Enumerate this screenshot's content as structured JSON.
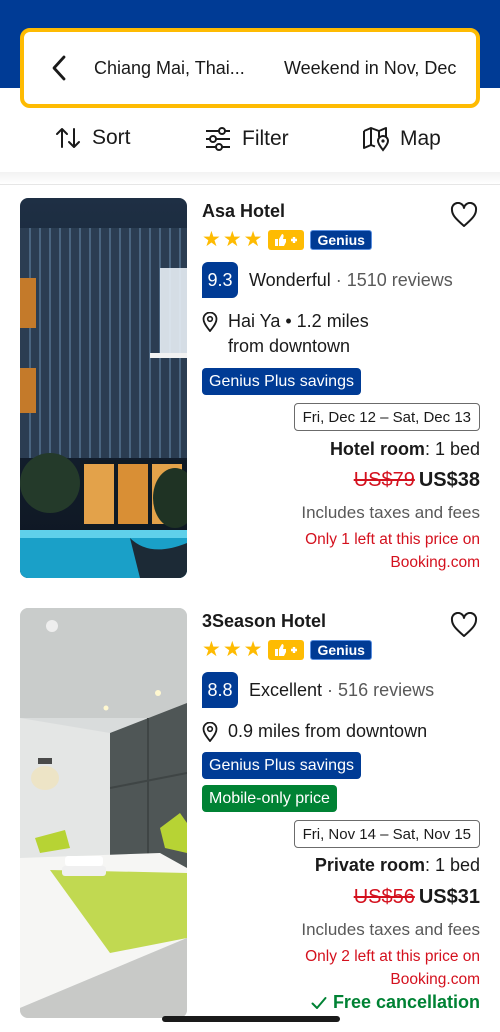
{
  "header": {
    "destination": "Chiang Mai, Thai...",
    "dates": "Weekend in Nov, Dec"
  },
  "toolbar": {
    "sort_label": "Sort",
    "filter_label": "Filter",
    "map_label": "Map"
  },
  "colors": {
    "brand_blue": "#003b95",
    "accent_yellow": "#febb02",
    "price_red": "#d4111e",
    "success_green": "#008234"
  },
  "hotels": [
    {
      "name": "Asa Hotel",
      "stars": 3,
      "genius_badge": "Genius",
      "score": "9.3",
      "score_word": "Wonderful",
      "reviews": "1510 reviews",
      "location_line1": "Hai Ya • 1.2 miles",
      "location_line2": "from downtown",
      "tag_genius_plus": "Genius Plus savings",
      "dates": "Fri, Dec 12 – Sat, Dec 13",
      "room_type": "Hotel room",
      "room_beds": ": 1 bed",
      "old_price": "US$79",
      "new_price": "US$38",
      "taxes": "Includes taxes and fees",
      "urgency_line1": "Only 1 left at this price on",
      "urgency_line2": "Booking.com",
      "image_alt": "hotel-facade-night-icon"
    },
    {
      "name": "3Season Hotel",
      "stars": 3,
      "genius_badge": "Genius",
      "score": "8.8",
      "score_word": "Excellent",
      "reviews": "516 reviews",
      "location_line1": "0.9 miles from downtown",
      "tag_genius_plus": "Genius Plus savings",
      "tag_mobile": "Mobile-only price",
      "dates": "Fri, Nov 14 – Sat, Nov 15",
      "room_type": "Private room",
      "room_beds": ": 1 bed",
      "old_price": "US$56",
      "new_price": "US$31",
      "taxes": "Includes taxes and fees",
      "urgency_line1": "Only 2 left at this price on",
      "urgency_line2": "Booking.com",
      "free_cancellation": "Free cancellation",
      "image_alt": "hotel-room-bed-icon"
    }
  ]
}
